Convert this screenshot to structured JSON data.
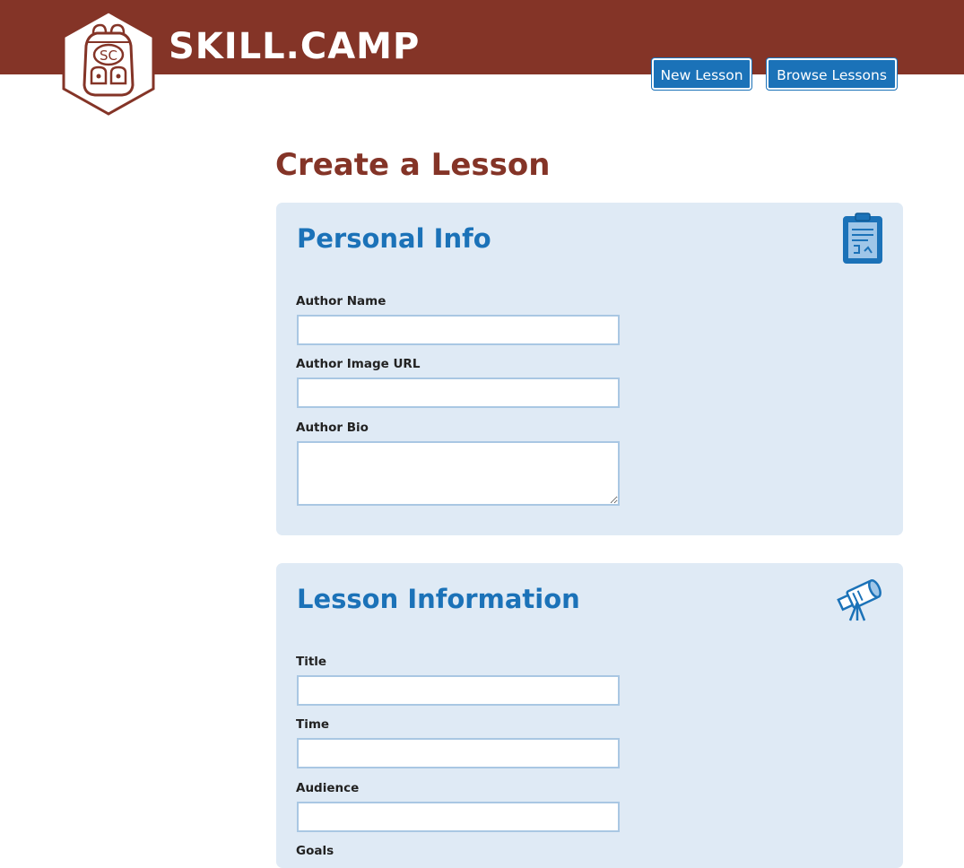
{
  "header": {
    "brand": "SKILL.CAMP",
    "logo_text": "SC",
    "colors": {
      "bar": "#843427",
      "accent": "#1b72b8"
    },
    "nav": [
      {
        "label": "New Lesson"
      },
      {
        "label": "Browse Lessons"
      }
    ]
  },
  "main": {
    "page_title": "Create a Lesson",
    "sections": [
      {
        "heading": "Personal Info",
        "icon": "clipboard-icon",
        "fields": [
          {
            "label": "Author Name",
            "value": ""
          },
          {
            "label": "Author Image URL",
            "value": ""
          },
          {
            "label": "Author Bio",
            "value": ""
          }
        ]
      },
      {
        "heading": "Lesson Information",
        "icon": "telescope-icon",
        "fields": [
          {
            "label": "Title",
            "value": ""
          },
          {
            "label": "Time",
            "value": ""
          },
          {
            "label": "Audience",
            "value": ""
          },
          {
            "label": "Goals",
            "value": ""
          }
        ]
      }
    ]
  }
}
